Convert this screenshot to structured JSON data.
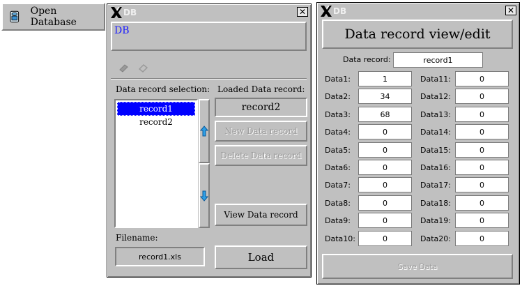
{
  "launcher": {
    "open_database_label": "Open Database",
    "icon": "database-icon"
  },
  "db_window": {
    "title": "DB",
    "header_text": "DB",
    "selection_label": "Data record selection:",
    "records": [
      "record1",
      "record2"
    ],
    "selected_record": "record1",
    "loaded_label": "Loaded Data record:",
    "loaded_value": "record2",
    "new_record_label": "New Data record",
    "delete_record_label": "Delete Data record",
    "view_record_label": "View Data record",
    "filename_label": "Filename:",
    "filename_value": "record1.xls",
    "load_label": "Load"
  },
  "view_window": {
    "title": "DB",
    "heading": "Data record view/edit",
    "record_label": "Data record:",
    "record_value": "record1",
    "fields_left": [
      {
        "label": "Data1:",
        "value": "1"
      },
      {
        "label": "Data2:",
        "value": "34"
      },
      {
        "label": "Data3:",
        "value": "68"
      },
      {
        "label": "Data4:",
        "value": "0"
      },
      {
        "label": "Data5:",
        "value": "0"
      },
      {
        "label": "Data6:",
        "value": "0"
      },
      {
        "label": "Data7:",
        "value": "0"
      },
      {
        "label": "Data8:",
        "value": "0"
      },
      {
        "label": "Data9:",
        "value": "0"
      },
      {
        "label": "Data10:",
        "value": "0"
      }
    ],
    "fields_right": [
      {
        "label": "Data11:",
        "value": "0"
      },
      {
        "label": "Data12:",
        "value": "0"
      },
      {
        "label": "Data13:",
        "value": "0"
      },
      {
        "label": "Data14:",
        "value": "0"
      },
      {
        "label": "Data15:",
        "value": "0"
      },
      {
        "label": "Data16:",
        "value": "0"
      },
      {
        "label": "Data17:",
        "value": "0"
      },
      {
        "label": "Data18:",
        "value": "0"
      },
      {
        "label": "Data19:",
        "value": "0"
      },
      {
        "label": "Data20:",
        "value": "0"
      }
    ],
    "save_label": "Save Data"
  },
  "colors": {
    "selection": "#0000ff",
    "face": "#c0c0c0",
    "header_text": "#1a1aff"
  }
}
